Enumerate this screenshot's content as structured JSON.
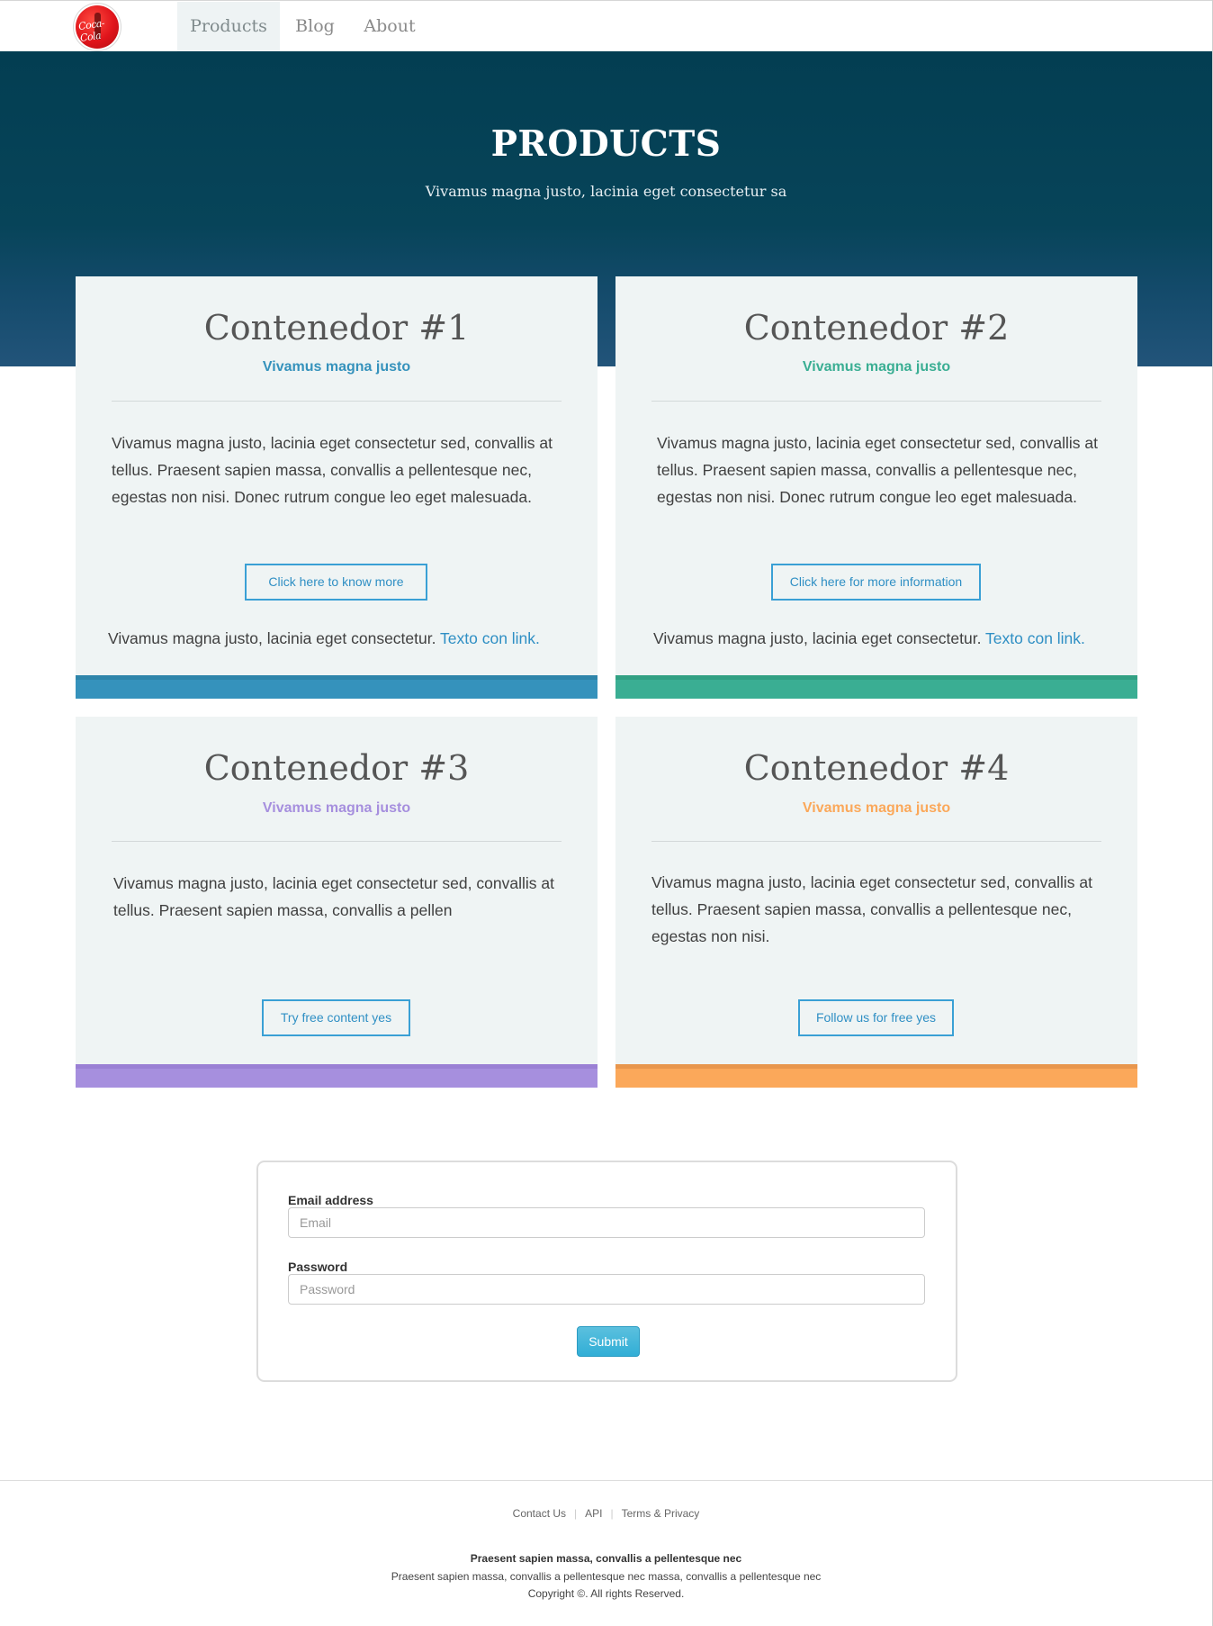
{
  "nav": {
    "logo_text": "Coca-Cola",
    "items": [
      {
        "label": "Products",
        "active": true
      },
      {
        "label": "Blog",
        "active": false
      },
      {
        "label": "About",
        "active": false
      }
    ]
  },
  "hero": {
    "title": "PRODUCTS",
    "subtitle": "Vivamus magna justo, lacinia eget consectetur sa"
  },
  "cards": [
    {
      "title": "Contenedor #1",
      "subtitle": "Vivamus magna justo",
      "accent": "#3592bc",
      "body": "Vivamus magna justo, lacinia eget consectetur sed, convallis at tellus. Praesent sapien massa, convallis a pellentesque nec, egestas non nisi. Donec rutrum congue leo eget malesuada.",
      "button": "Click here to know more",
      "footer_text": "Vivamus magna justo, lacinia eget consectetur.",
      "footer_link": "Texto con link."
    },
    {
      "title": "Contenedor #2",
      "subtitle": "Vivamus magna justo",
      "accent": "#3aae93",
      "body": "Vivamus magna justo, lacinia eget consectetur sed, convallis at tellus. Praesent sapien massa, convallis a pellentesque nec, egestas non nisi. Donec rutrum congue leo eget malesuada.",
      "button": "Click here for  more information",
      "footer_text": "Vivamus magna justo, lacinia eget consectetur.",
      "footer_link": "Texto con link."
    },
    {
      "title": "Contenedor #3",
      "subtitle": "Vivamus magna justo",
      "accent": "#a68fde",
      "body": "Vivamus magna justo, lacinia eget consectetur sed, convallis at tellus. Praesent sapien massa, convallis a pellen",
      "button": "Try  free content yes"
    },
    {
      "title": "Contenedor #4",
      "subtitle": "Vivamus magna justo",
      "accent": "#fba85a",
      "body": "Vivamus magna justo, lacinia eget consectetur sed, convallis at tellus. Praesent sapien massa, convallis a pellentesque nec, egestas non nisi.",
      "button": "Follow us for free yes"
    }
  ],
  "form": {
    "email_label": "Email address",
    "email_placeholder": "Email",
    "password_label": "Password",
    "password_placeholder": "Password",
    "submit": "Submit"
  },
  "footer": {
    "links": [
      "Contact Us",
      "API",
      "Terms & Privacy"
    ],
    "bold_line": "Praesent sapien massa, convallis a pellentesque nec",
    "line": "Praesent sapien massa, convallis a pellentesque nec massa, convallis a pellentesque nec",
    "copyright": "Copyright ©.  All rights Reserved."
  },
  "colors": {
    "hero_bg": "#033e52",
    "card_bg": "#eff4f4",
    "link": "#2f8fc4",
    "card1_sub": "#3592bc",
    "card2_sub": "#3aae93",
    "card3_sub": "#a68fde",
    "card4_sub": "#fba85a",
    "card1_bar_top": "#2e85aa",
    "card2_bar_top": "#31a083",
    "card3_bar_top": "#9a80d4",
    "card4_bar_top": "#e8964d"
  }
}
